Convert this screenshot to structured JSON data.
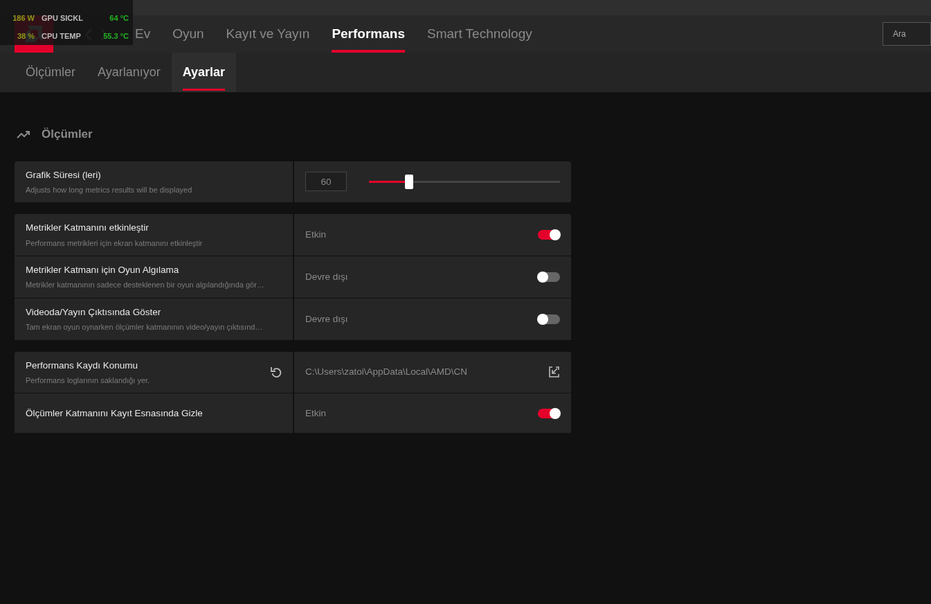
{
  "overlay": {
    "rows": [
      {
        "value": "186 W",
        "label": "GPU SICKL",
        "reading": "64 °C"
      },
      {
        "value": "38 %",
        "label": "CPU TEMP",
        "reading": "55.3 °C"
      }
    ]
  },
  "nav": {
    "tabs": [
      {
        "label": "Ev",
        "selected": false
      },
      {
        "label": "Oyun",
        "selected": false
      },
      {
        "label": "Kayıt ve Yayın",
        "selected": false
      },
      {
        "label": "Performans",
        "selected": true
      },
      {
        "label": "Smart Technology",
        "selected": false
      }
    ],
    "search": {
      "placeholder": "Ara"
    }
  },
  "subtabs": [
    {
      "label": "Ölçümler",
      "selected": false
    },
    {
      "label": "Ayarlanıyor",
      "selected": false
    },
    {
      "label": "Ayarlar",
      "selected": true
    }
  ],
  "section": {
    "title": "Ölçümler"
  },
  "groups": [
    [
      {
        "kind": "slider",
        "title": "Grafik Süresi (leri)",
        "description": "Adjusts how long metrics results will be displayed",
        "value": "60",
        "level": 0.21
      }
    ],
    [
      {
        "kind": "toggle",
        "title": "Metrikler Katmanını etkinleştir",
        "description": "Performans metrikleri için ekran katmanını etkinleştir",
        "status": "Etkin",
        "on": true
      },
      {
        "kind": "toggle",
        "title": "Metrikler Katmanı için Oyun Algılama",
        "description": "Metrikler katmanının sadece desteklenen bir oyun algılandığında gör…",
        "status": "Devre dışı",
        "on": false
      },
      {
        "kind": "toggle",
        "title": "Videoda/Yayın Çıktısında Göster",
        "description": "Tam ekran oyun oynarken ölçümler katmanının video/yayın çıktısınd…",
        "status": "Devre dışı",
        "on": false
      }
    ],
    [
      {
        "kind": "path",
        "title": "Performans Kaydı Konumu",
        "description": "Performans loglarının saklandığı yer.",
        "path": "C:\\Users\\zatoi\\AppData\\Local\\AMD\\CN"
      },
      {
        "kind": "toggle",
        "title": "Ölçümler Katmanını Kayıt Esnasında Gizle",
        "status": "Etkin",
        "on": true
      }
    ]
  ]
}
